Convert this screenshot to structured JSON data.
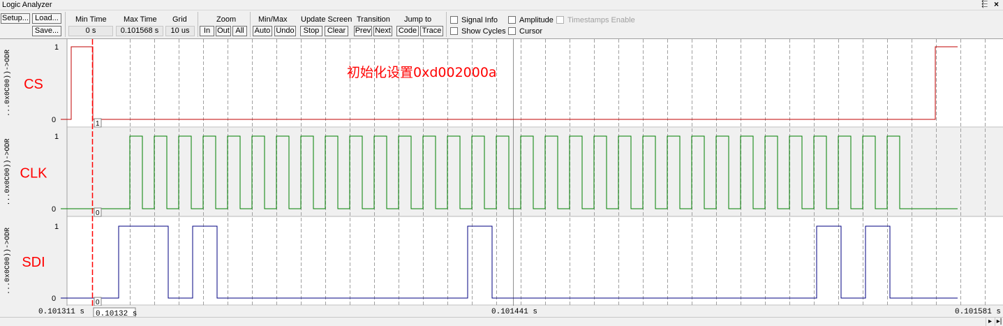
{
  "window": {
    "title": "Logic Analyzer",
    "pin": "⬱",
    "close": "×"
  },
  "toolbar": {
    "setup": "Setup...",
    "load": "Load...",
    "save": "Save...",
    "min_time_label": "Min Time",
    "min_time_value": "0 s",
    "max_time_label": "Max Time",
    "max_time_value": "0.101568 s",
    "grid_label": "Grid",
    "grid_value": "10 us",
    "zoom_label": "Zoom",
    "zoom_in": "In",
    "zoom_out": "Out",
    "zoom_all": "All",
    "minmax_label": "Min/Max",
    "minmax_auto": "Auto",
    "minmax_undo": "Undo",
    "update_label": "Update Screen",
    "update_stop": "Stop",
    "update_clear": "Clear",
    "transition_label": "Transition",
    "transition_prev": "Prev",
    "transition_next": "Next",
    "jump_label": "Jump to",
    "jump_code": "Code",
    "jump_trace": "Trace",
    "signal_info": "Signal Info",
    "show_cycles": "Show Cycles",
    "amplitude": "Amplitude",
    "cursor": "Cursor",
    "timestamps": "Timestamps Enable"
  },
  "annotation": "初始化设置0xd002000a",
  "signals": [
    {
      "name": "CS",
      "expr": "...0x0C00))->ODR",
      "high_label": "1",
      "low_label": "0",
      "cursor_value": "1",
      "color": "#c00000"
    },
    {
      "name": "CLK",
      "expr": "...0x0C00))->ODR",
      "high_label": "1",
      "low_label": "0",
      "cursor_value": "0",
      "color": "#008000"
    },
    {
      "name": "SDI",
      "expr": "...0x0C00))->ODR",
      "high_label": "1",
      "low_label": "0",
      "cursor_value": "0",
      "color": "#000080"
    }
  ],
  "time_axis": {
    "start": "0.101311  s",
    "cursor": "0.10132  s",
    "middle": "0.101441  s",
    "end": "0.101581  s"
  },
  "colors": {
    "label_red": "#ff0000",
    "cursor_red": "#ff0000",
    "grid": "#a0a0a0"
  }
}
